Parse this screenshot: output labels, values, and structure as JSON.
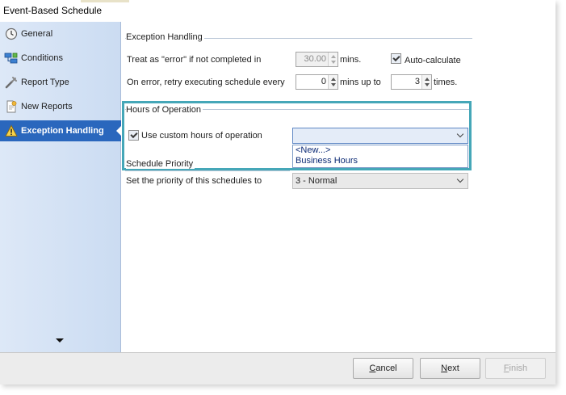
{
  "window": {
    "title": "Event-Based Schedule"
  },
  "sidebar": {
    "items": [
      {
        "label": "General",
        "icon": "clock-icon"
      },
      {
        "label": "Conditions",
        "icon": "conditions-icon"
      },
      {
        "label": "Report Type",
        "icon": "wrench-icon"
      },
      {
        "label": "New Reports",
        "icon": "report-icon"
      },
      {
        "label": "Exception Handling",
        "icon": "warning-icon",
        "active": true
      }
    ]
  },
  "exception_handling": {
    "section_label": "Exception Handling",
    "error_label": "Treat as \"error\" if not completed in",
    "error_value": "30.00",
    "error_unit": "mins.",
    "auto_calculate_label": "Auto-calculate",
    "auto_calculate_checked": true,
    "retry_label": "On error, retry  executing schedule every",
    "retry_every_value": "0",
    "retry_mins_label": "mins up to",
    "retry_times_value": "3",
    "retry_times_label": "times."
  },
  "hours_of_operation": {
    "section_label": "Hours of Operation",
    "custom_hours_label": "Use custom hours of operation",
    "custom_hours_checked": true,
    "selected_value": "",
    "options": [
      "<New...>",
      "Business Hours"
    ]
  },
  "schedule_priority": {
    "section_label": "Schedule Priority",
    "priority_label": "Set the priority of this schedules to",
    "priority_value": "3 - Normal"
  },
  "footer": {
    "cancel_label": "ancel",
    "cancel_accel": "C",
    "next_label": "ext",
    "next_accel": "N",
    "finish_label": "inish",
    "finish_accel": "F"
  },
  "colors": {
    "sidebar_active": "#2a67bd",
    "highlight_box": "#45a7b8",
    "sidebar_bg": "#d5e2f4"
  }
}
